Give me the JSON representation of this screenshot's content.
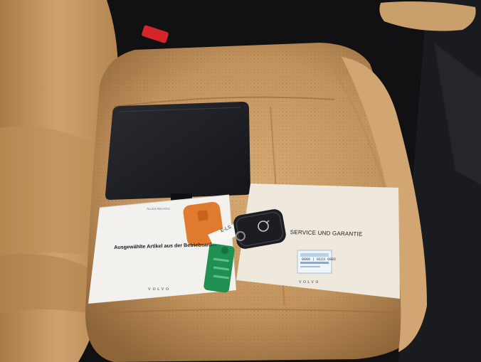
{
  "photo": {
    "booklet_left": {
      "header": "ALLES RICHTIG",
      "title": "Ausgewählte Artikel aus der Betriebsanl…",
      "brand": "VOLVO"
    },
    "booklet_right": {
      "title": "SERVICE UND GARANTIE",
      "sticker_code": "0000 | 0123 6002",
      "brand": "VOLVO"
    },
    "key_tag": {
      "label": "E-LS"
    },
    "colors": {
      "leather": "#c79a64",
      "portfolio": "#1c1d22",
      "key_orange": "#e07a2e",
      "tag_green": "#1f8f52"
    }
  }
}
